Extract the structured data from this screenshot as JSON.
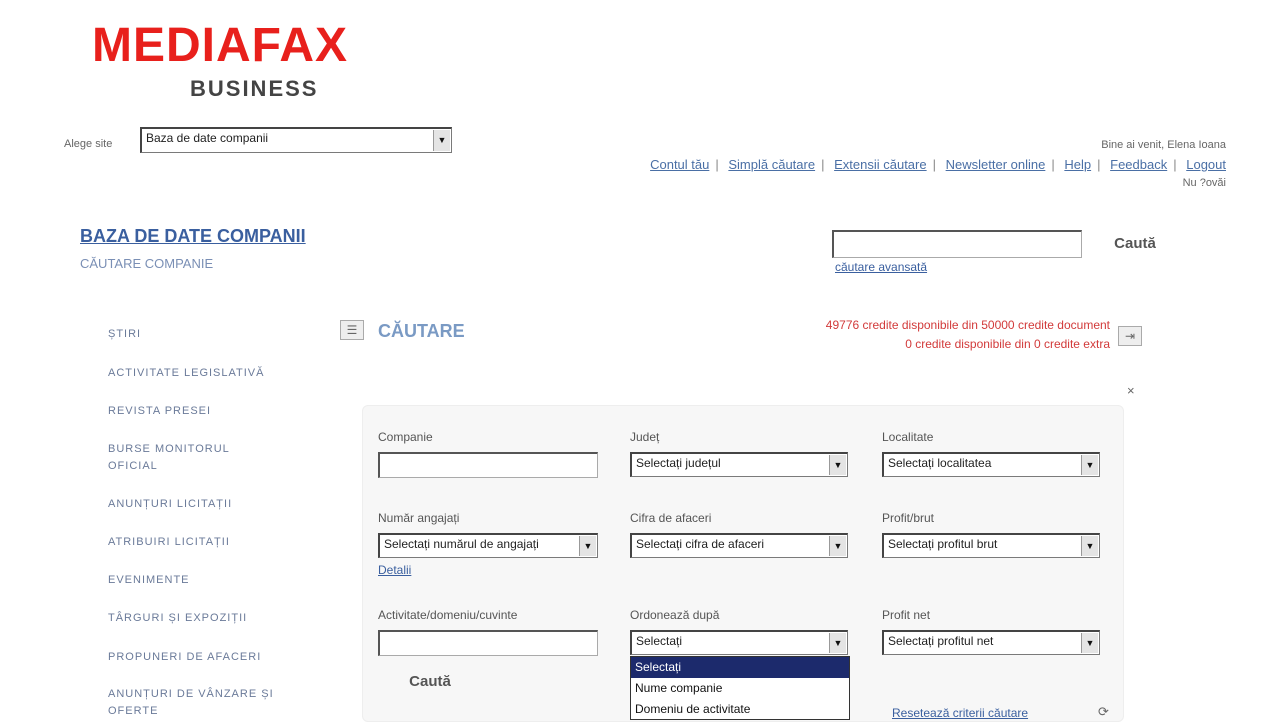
{
  "brand": {
    "name": "MEDIAFAX",
    "sub": "BUSINESS"
  },
  "top_nav": {
    "label": "Alege site",
    "site_select_value": "Baza de date companii"
  },
  "user": {
    "welcome": "Bine ai venit, Elena Ioana",
    "second_line": "Nu ?ovăi"
  },
  "top_links": [
    "Contul tău",
    "Simplă căutare",
    "Extensii căutare",
    "Newsletter online",
    "Help",
    "Feedback",
    "Logout"
  ],
  "section": {
    "title": "BAZA DE DATE COMPANII",
    "subtitle": "CĂUTARE COMPANIE"
  },
  "search": {
    "input_value": "",
    "button_label": "Caută",
    "advanced_link": "căutare avansată"
  },
  "sidebar": {
    "items": [
      "ȘTIRI",
      "ACTIVITATE LEGISLATIVĂ",
      "REVISTA PRESEI",
      "BURSE MONITORUL OFICIAL",
      "ANUNȚURI LICITAȚII",
      "ATRIBUIRI LICITAȚII",
      "EVENIMENTE",
      "TÂRGURI ȘI EXPOZIȚII",
      "PROPUNERI DE AFACERI",
      "ANUNȚURI DE VÂNZARE ȘI OFERTE"
    ]
  },
  "cautare": {
    "title": "CĂUTARE",
    "credits_line1": "49776 credite disponibile din 50000 credite document",
    "credits_line2": "0 credite disponibile din 0 credite extra"
  },
  "form": {
    "companie_label": "Companie",
    "companie_value": "",
    "judet_label": "Județ",
    "judet_value": "Selectați județul",
    "localitate_label": "Localitate",
    "localitate_value": "Selectați localitatea",
    "angajati_label": "Număr angajați",
    "angajati_value": "Selectați numărul de angajați",
    "cifra_label": "Cifra de afaceri",
    "cifra_value": "Selectați cifra de afaceri",
    "profit_label": "Profit/brut",
    "profit_value": "Selectați profitul brut",
    "details_link": "Detalii",
    "activitate_label": "Activitate/domeniu/cuvinte",
    "activitate_value": "",
    "ordonare_label": "Ordonează după",
    "ordonare_value": "Selectați",
    "profitnet_label": "Profit net",
    "profitnet_value": "Selectați profitul net",
    "search_button": "Caută",
    "reset_link": "Resetează criterii căutare",
    "dropdown_options": [
      "Selectați",
      "Nume companie",
      "Domeniu de activitate"
    ]
  },
  "colors": {
    "brand_red": "#e8201c",
    "link_blue": "#3a5f9f",
    "credit_red": "#d23a3a",
    "selected_option": "#1c2a6c"
  }
}
